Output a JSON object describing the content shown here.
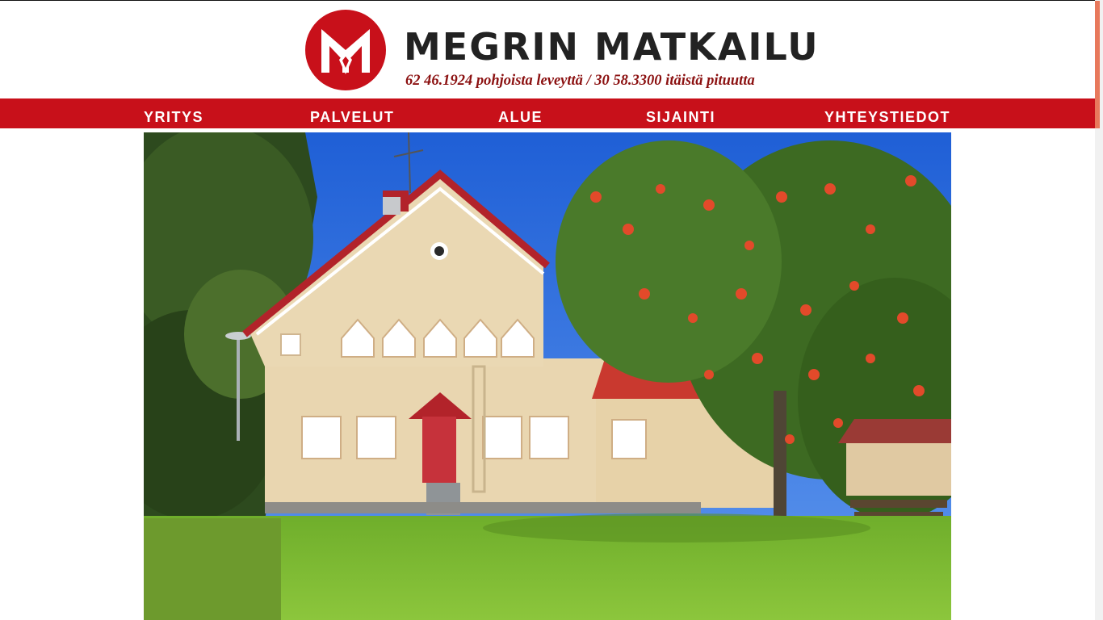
{
  "header": {
    "brand_title": "MEGRIN MATKAILU",
    "brand_coords": "62 46.1924 pohjoista leveyttä / 30 58.3300 itäistä pituutta",
    "logo_icon": "m-monogram-logo"
  },
  "nav": {
    "items": [
      {
        "label": "YRITYS"
      },
      {
        "label": "PALVELUT"
      },
      {
        "label": "ALUE"
      },
      {
        "label": "SIJAINTI"
      },
      {
        "label": "YHTEYSTIEDOT"
      }
    ]
  },
  "colors": {
    "brand_red": "#c8101a",
    "coords_text": "#8b1010",
    "title_text": "#222222",
    "scroll_thumb": "#e8795c"
  }
}
